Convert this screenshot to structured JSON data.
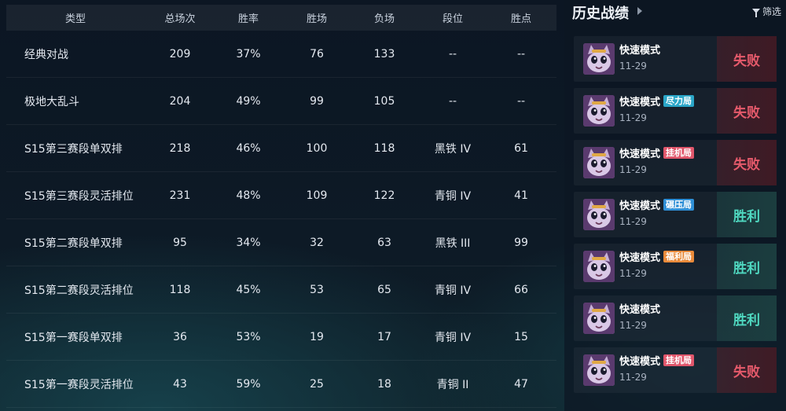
{
  "stats": {
    "headers": {
      "type": "类型",
      "total": "总场次",
      "rate": "胜率",
      "win": "胜场",
      "loss": "负场",
      "rank": "段位",
      "lp": "胜点"
    },
    "rows": [
      {
        "type": "经典对战",
        "total": "209",
        "rate": "37%",
        "win": "76",
        "loss": "133",
        "rank": "--",
        "lp": "--"
      },
      {
        "type": "极地大乱斗",
        "total": "204",
        "rate": "49%",
        "win": "99",
        "loss": "105",
        "rank": "--",
        "lp": "--"
      },
      {
        "type": "S15第三赛段单双排",
        "total": "218",
        "rate": "46%",
        "win": "100",
        "loss": "118",
        "rank": "黑铁 IV",
        "lp": "61"
      },
      {
        "type": "S15第三赛段灵活排位",
        "total": "231",
        "rate": "48%",
        "win": "109",
        "loss": "122",
        "rank": "青铜 IV",
        "lp": "41"
      },
      {
        "type": "S15第二赛段单双排",
        "total": "95",
        "rate": "34%",
        "win": "32",
        "loss": "63",
        "rank": "黑铁 III",
        "lp": "99"
      },
      {
        "type": "S15第二赛段灵活排位",
        "total": "118",
        "rate": "45%",
        "win": "53",
        "loss": "65",
        "rank": "青铜 IV",
        "lp": "66"
      },
      {
        "type": "S15第一赛段单双排",
        "total": "36",
        "rate": "53%",
        "win": "19",
        "loss": "17",
        "rank": "青铜 IV",
        "lp": "15"
      },
      {
        "type": "S15第一赛段灵活排位",
        "total": "43",
        "rate": "59%",
        "win": "25",
        "loss": "18",
        "rank": "青铜 II",
        "lp": "47"
      }
    ]
  },
  "history": {
    "title": "历史战绩",
    "filter_label": "筛选",
    "filter_icon": "funnel-icon",
    "matches": [
      {
        "mode": "快速模式",
        "tag": "",
        "tag_color": "",
        "date": "11-29",
        "result": "失败",
        "outcome": "loss"
      },
      {
        "mode": "快速模式",
        "tag": "尽力局",
        "tag_color": "#2aa6c8",
        "date": "11-29",
        "result": "失败",
        "outcome": "loss"
      },
      {
        "mode": "快速模式",
        "tag": "挂机局",
        "tag_color": "#e0566b",
        "date": "11-29",
        "result": "失败",
        "outcome": "loss"
      },
      {
        "mode": "快速模式",
        "tag": "碾压局",
        "tag_color": "#2f8fd6",
        "date": "11-29",
        "result": "胜利",
        "outcome": "win"
      },
      {
        "mode": "快速模式",
        "tag": "福利局",
        "tag_color": "#e98a3a",
        "date": "11-29",
        "result": "胜利",
        "outcome": "win"
      },
      {
        "mode": "快速模式",
        "tag": "",
        "tag_color": "",
        "date": "11-29",
        "result": "胜利",
        "outcome": "win"
      },
      {
        "mode": "快速模式",
        "tag": "挂机局",
        "tag_color": "#e0566b",
        "date": "11-29",
        "result": "失败",
        "outcome": "loss"
      }
    ]
  }
}
